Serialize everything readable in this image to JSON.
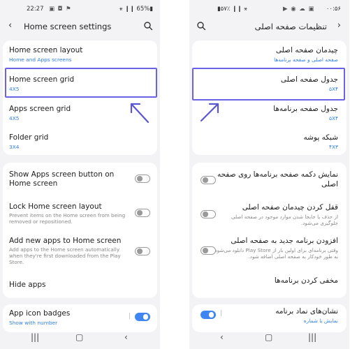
{
  "left": {
    "status": {
      "time": "22:27",
      "icons": "▣ ◘ ⚑",
      "battery": "⚹ ❙❙ 65%▮"
    },
    "appbar": {
      "title": "Home screen settings"
    },
    "card1": [
      {
        "title": "Home screen layout",
        "sub": "Home and Apps screens"
      },
      {
        "title": "Home screen grid",
        "sub": "4X5"
      },
      {
        "title": "Apps screen grid",
        "sub": "4X5"
      },
      {
        "title": "Folder grid",
        "sub": "3X4"
      }
    ],
    "card2": [
      {
        "title_line1": "Show Apps screen button on",
        "title_line2": "Home screen"
      },
      {
        "title": "Lock Home screen layout",
        "desc_line1": "Prevent items on the Home screen from being",
        "desc_line2": "removed or repositioned."
      },
      {
        "title": "Add new apps to Home screen",
        "desc_line1": "Add apps to the Home screen automatically",
        "desc_line2": "when they're first downloaded from the Play",
        "desc_line3": "Store."
      },
      {
        "title": "Hide apps"
      }
    ],
    "card3": [
      {
        "title": "App icon badges",
        "sub": "Show with number"
      }
    ]
  },
  "right": {
    "status": {
      "time": "۰۰:۵۶",
      "icons": "▶ ◉ ☁ ▣",
      "battery": "▮۵۷٪ ❙❙ ⚹"
    },
    "appbar": {
      "title": "تنظیمات صفحه اصلی"
    },
    "card1": [
      {
        "title": "چیدمان صفحه اصلی",
        "sub": "صفحه اصلی و صفحه برنامه‌ها"
      },
      {
        "title": "جدول صفحه اصلی",
        "sub": "۵X۴"
      },
      {
        "title": "جدول صفحه برنامه‌ها",
        "sub": "۵X۴"
      },
      {
        "title": "شبکه پوشه",
        "sub": "۴X۳"
      }
    ],
    "card2": [
      {
        "title_line1": "نمایش دکمه صفحه برنامه‌ها روی صفحه",
        "title_line2": "اصلی"
      },
      {
        "title": "قفل کردن چیدمان صفحه اصلی",
        "desc_line1": "از حذف یا جابجا شدن موارد موجود در صفحه اصلی",
        "desc_line2": "جلوگیری می‌شود."
      },
      {
        "title": "افزودن برنامه جدید به صفحه اصلی",
        "desc_line1": "وقتی برنامه‌ای برای اولین بار از Play Store دانلود می‌شود،",
        "desc_line2": "به طور خودکار به صفحه اصلی اضافه شود."
      },
      {
        "title": "مخفی کردن برنامه‌ها"
      }
    ],
    "card3": [
      {
        "title": "نشان‌های نماد برنامه",
        "sub": "نمایش با شماره"
      }
    ]
  },
  "toggles": {
    "left_show_apps_button": "off",
    "left_lock_layout": "off",
    "left_add_new_apps": "off",
    "left_app_icon_badges": "on",
    "right_show_apps_button": "off",
    "right_lock_layout": "off",
    "right_add_new_apps": "off",
    "right_app_icon_badges": "on"
  },
  "colors": {
    "accent": "#3f86f4",
    "highlight": "#6b63e6",
    "subtext": "#2f7fe6",
    "background": "#f3f3f5"
  }
}
